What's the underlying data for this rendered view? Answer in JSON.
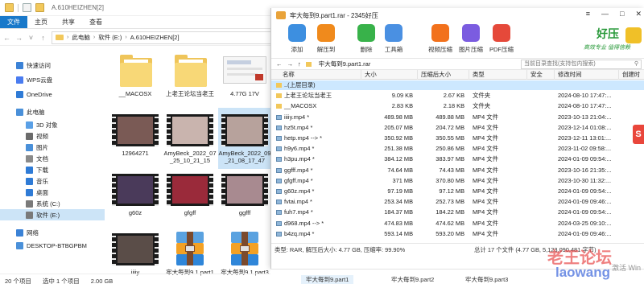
{
  "explorer": {
    "title": "A.610HEIZHEN[2]",
    "ribbon_tabs": [
      "文件",
      "主页",
      "共享",
      "查看"
    ],
    "path": [
      "此电脑",
      "软件 (E:)",
      "A.610HEIZHEN[2]"
    ],
    "nav": [
      {
        "label": "快速访问",
        "icon": "star-icon",
        "color": "#3b82d6"
      },
      {
        "label": "WPS云盘",
        "icon": "cloud-icon",
        "color": "#4a7cf0"
      },
      {
        "label": "OneDrive",
        "icon": "onedrive-icon",
        "color": "#2f7bd6"
      },
      {
        "label": "此电脑",
        "icon": "computer-icon",
        "color": "#4a90d9"
      },
      {
        "label": "3D 对象",
        "icon": "cube-icon",
        "color": "#5aa0e6"
      },
      {
        "label": "视频",
        "icon": "video-icon",
        "color": "#6b6b6b"
      },
      {
        "label": "图片",
        "icon": "pictures-icon",
        "color": "#4a90d9"
      },
      {
        "label": "文档",
        "icon": "documents-icon",
        "color": "#8a8a8a"
      },
      {
        "label": "下载",
        "icon": "download-icon",
        "color": "#2f7bd6"
      },
      {
        "label": "音乐",
        "icon": "music-icon",
        "color": "#2f7bd6"
      },
      {
        "label": "桌面",
        "icon": "desktop-icon",
        "color": "#2f7bd6"
      },
      {
        "label": "系统 (C:)",
        "icon": "drive-icon",
        "color": "#7a7a7a"
      },
      {
        "label": "软件 (E:)",
        "icon": "drive-icon",
        "color": "#7a7a7a"
      },
      {
        "label": "网络",
        "icon": "network-icon",
        "color": "#3b82d6"
      },
      {
        "label": "DESKTOP-BTBGPBM",
        "icon": "pc-icon",
        "color": "#4a90d9"
      }
    ],
    "files": [
      {
        "name": "__MACOSX",
        "kind": "folder"
      },
      {
        "name": "上老王论坛当老王",
        "kind": "folder"
      },
      {
        "name": "4.77G 17V",
        "kind": "image"
      },
      {
        "name": "12964271",
        "kind": "video"
      },
      {
        "name": "AmyBeck_2022_07_25_10_21_15",
        "kind": "video"
      },
      {
        "name": "AmyBeck_2022_09_21_08_17_47",
        "kind": "video"
      },
      {
        "name": "g60z",
        "kind": "video"
      },
      {
        "name": "gfgff",
        "kind": "video"
      },
      {
        "name": "ggfff",
        "kind": "video"
      },
      {
        "name": "iiiiy",
        "kind": "video"
      },
      {
        "name": "牢大每到9.1.part1",
        "kind": "rar"
      },
      {
        "name": "牢大每到9.1.part3",
        "kind": "rar"
      }
    ],
    "status": {
      "count": "20 个项目",
      "selected": "选中 1 个项目",
      "size": "2.00 GB"
    }
  },
  "zip": {
    "title": "牢大每到9.part1.rar - 2345好压",
    "toolbar": [
      {
        "label": "添加",
        "icon": "add-icon",
        "color": "#3d8fe0"
      },
      {
        "label": "解压到",
        "icon": "extract-icon",
        "color": "#f08a1c"
      },
      {
        "label": "删除",
        "icon": "delete-icon",
        "color": "#38b24a"
      },
      {
        "label": "工具箱",
        "icon": "toolbox-icon",
        "color": "#4a90e2"
      },
      {
        "label": "视频压缩",
        "icon": "video-compress-icon",
        "color": "#f2711c"
      },
      {
        "label": "图片压缩",
        "icon": "image-compress-icon",
        "color": "#7b5ce0"
      },
      {
        "label": "PDF压缩",
        "icon": "pdf-compress-icon",
        "color": "#e5493a"
      }
    ],
    "brand": {
      "name": "好压",
      "tagline": "高效专业 值得信赖"
    },
    "path": "牢大每到9.part1.rar",
    "search_placeholder": "当前目录查找(支持包内搜索)",
    "columns": [
      "名称",
      "大小",
      "压缩后大小",
      "类型",
      "安全",
      "修改时间",
      "创建时"
    ],
    "rows": [
      {
        "name": "..(上层目录)",
        "size": "",
        "packed": "",
        "type": "",
        "mtime": "",
        "icon": "up"
      },
      {
        "name": "上老王论坛当老王",
        "size": "9.09 KB",
        "packed": "2.67 KB",
        "type": "文件夹",
        "mtime": "2024-08-10 17:47:...",
        "icon": "folder"
      },
      {
        "name": "__MACOSX",
        "size": "2.83 KB",
        "packed": "2.18 KB",
        "type": "文件夹",
        "mtime": "2024-08-10 17:47:...",
        "icon": "folder"
      },
      {
        "name": "iiiiy.mp4 *",
        "size": "489.98 MB",
        "packed": "489.88 MB",
        "type": "MP4 文件",
        "mtime": "2023-10-13 21:04:...",
        "icon": "mp4"
      },
      {
        "name": "hz5t.mp4 *",
        "size": "205.07 MB",
        "packed": "204.72 MB",
        "type": "MP4 文件",
        "mtime": "2023-12-14 01:08:...",
        "icon": "mp4"
      },
      {
        "name": "hetp.mp4 --> *",
        "size": "350.92 MB",
        "packed": "350.55 MB",
        "type": "MP4 文件",
        "mtime": "2023-12-11 13:01:...",
        "icon": "mp4"
      },
      {
        "name": "h9y6.mp4 *",
        "size": "251.38 MB",
        "packed": "250.86 MB",
        "type": "MP4 文件",
        "mtime": "2023-11-02 09:58:...",
        "icon": "mp4"
      },
      {
        "name": "h3pu.mp4 *",
        "size": "384.12 MB",
        "packed": "383.97 MB",
        "type": "MP4 文件",
        "mtime": "2024-01-09 09:54:...",
        "icon": "mp4"
      },
      {
        "name": "ggfff.mp4 *",
        "size": "74.64 MB",
        "packed": "74.43 MB",
        "type": "MP4 文件",
        "mtime": "2023-10-16 21:35:...",
        "icon": "mp4"
      },
      {
        "name": "gfgff.mp4 *",
        "size": "371 MB",
        "packed": "370.80 MB",
        "type": "MP4 文件",
        "mtime": "2023-10-30 11:32:...",
        "icon": "mp4"
      },
      {
        "name": "g60z.mp4 *",
        "size": "97.19 MB",
        "packed": "97.12 MB",
        "type": "MP4 文件",
        "mtime": "2024-01-09 09:54:...",
        "icon": "mp4"
      },
      {
        "name": "fvtai.mp4 *",
        "size": "253.34 MB",
        "packed": "252.73 MB",
        "type": "MP4 文件",
        "mtime": "2024-01-09 09:46:...",
        "icon": "mp4"
      },
      {
        "name": "fuh7.mp4 *",
        "size": "184.37 MB",
        "packed": "184.22 MB",
        "type": "MP4 文件",
        "mtime": "2024-01-09 09:54:...",
        "icon": "mp4"
      },
      {
        "name": "d968.mp4 --> *",
        "size": "474.83 MB",
        "packed": "474.62 MB",
        "type": "MP4 文件",
        "mtime": "2024-03-25 09:10:...",
        "icon": "mp4"
      },
      {
        "name": "b4zq.mp4 *",
        "size": "593.14 MB",
        "packed": "593.20 MB",
        "type": "MP4 文件",
        "mtime": "2024-01-09 09:46:...",
        "icon": "mp4"
      }
    ],
    "status_left": "类型: RAR, 解压后大小: 4.77 GB, 压缩率: 99.90%",
    "status_right": "总计 17 个文件 (4.77 GB, 5,123,090,481 字节)"
  },
  "taskbar": [
    "牢大每到9.part1",
    "牢大每到9.part2",
    "牢大每到9.part3"
  ],
  "overlay": {
    "side_tab": "S",
    "watermark": "老王论坛",
    "watermark_url": "laowang",
    "activate": "激活 Win"
  }
}
